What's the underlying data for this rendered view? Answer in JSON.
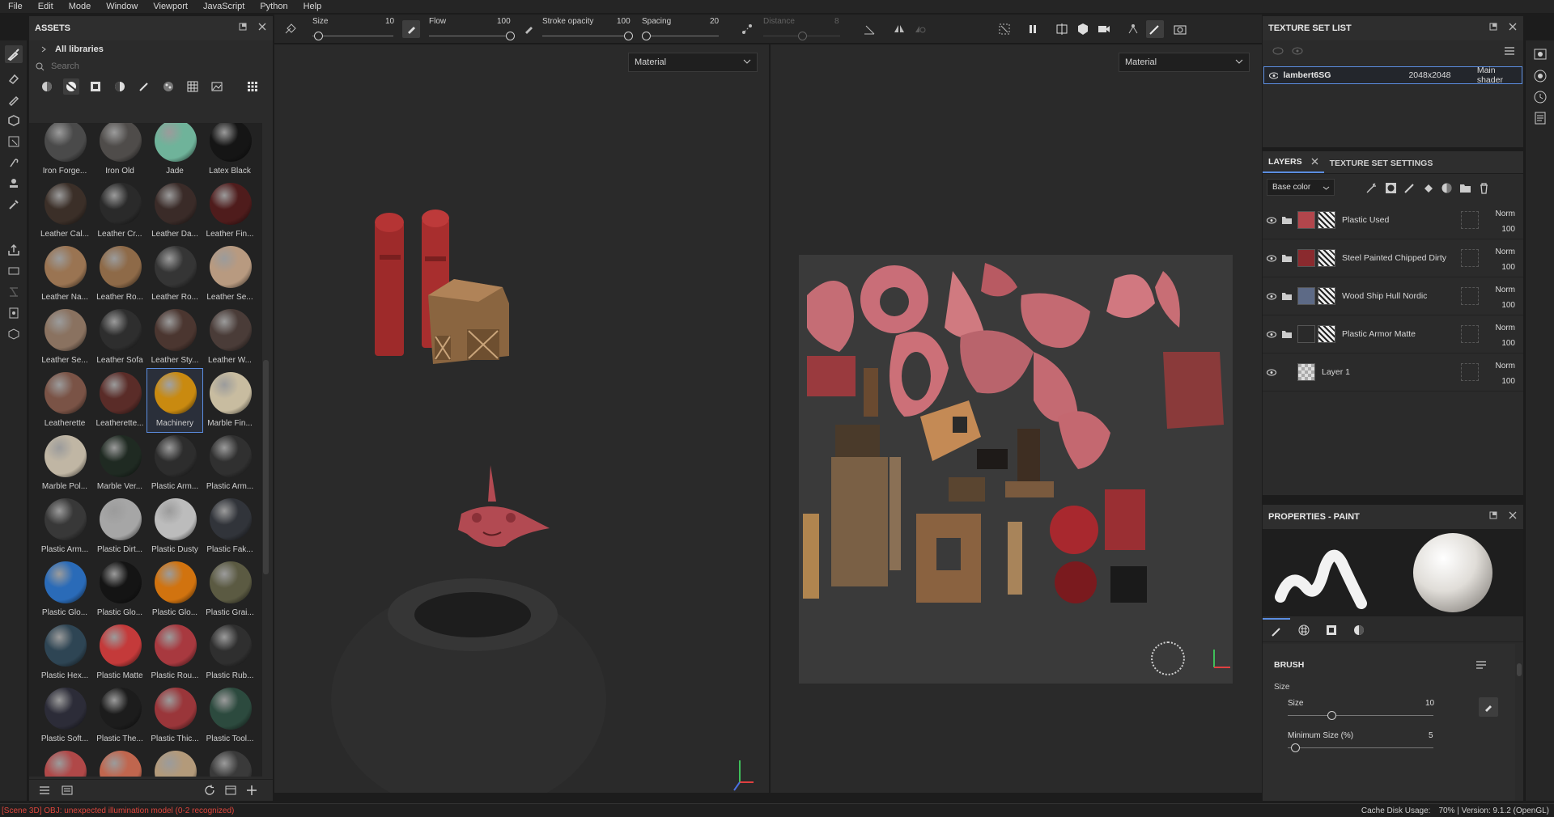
{
  "menu": [
    "File",
    "Edit",
    "Mode",
    "Window",
    "Viewport",
    "JavaScript",
    "Python",
    "Help"
  ],
  "assets": {
    "title": "ASSETS",
    "library": "All libraries",
    "search_placeholder": "Search",
    "materials": [
      {
        "label": "Iron Forge...",
        "color": "#4a4a4a"
      },
      {
        "label": "Iron Old",
        "color": "#4f4c4a"
      },
      {
        "label": "Jade",
        "color": "#6fb39a"
      },
      {
        "label": "Latex Black",
        "color": "#151515"
      },
      {
        "label": "Leather Cal...",
        "color": "#3b2f28"
      },
      {
        "label": "Leather Cr...",
        "color": "#2a2a2a"
      },
      {
        "label": "Leather Da...",
        "color": "#3a2b28"
      },
      {
        "label": "Leather Fin...",
        "color": "#4f1c1c"
      },
      {
        "label": "Leather Na...",
        "color": "#9a7452"
      },
      {
        "label": "Leather Ro...",
        "color": "#8e6a48"
      },
      {
        "label": "Leather Ro...",
        "color": "#353535"
      },
      {
        "label": "Leather Se...",
        "color": "#b89a80"
      },
      {
        "label": "Leather Se...",
        "color": "#8a7260"
      },
      {
        "label": "Leather Sofa",
        "color": "#2e2e2e"
      },
      {
        "label": "Leather Sty...",
        "color": "#4b3630"
      },
      {
        "label": "Leather W...",
        "color": "#4a3c38"
      },
      {
        "label": "Leatherette",
        "color": "#7a5346"
      },
      {
        "label": "Leatherette...",
        "color": "#5a2c28"
      },
      {
        "label": "Machinery",
        "color": "#c98a10"
      },
      {
        "label": "Marble Fin...",
        "color": "#c8bca0"
      },
      {
        "label": "Marble Pol...",
        "color": "#c0b6a4"
      },
      {
        "label": "Marble Ver...",
        "color": "#1f2a22"
      },
      {
        "label": "Plastic Arm...",
        "color": "#2d2d2d"
      },
      {
        "label": "Plastic Arm...",
        "color": "#303030"
      },
      {
        "label": "Plastic Arm...",
        "color": "#383838"
      },
      {
        "label": "Plastic Dirt...",
        "color": "#a6a6a6"
      },
      {
        "label": "Plastic Dusty",
        "color": "#bcbcbc"
      },
      {
        "label": "Plastic Fak...",
        "color": "#31343a"
      },
      {
        "label": "Plastic Glo...",
        "color": "#2a6bb8"
      },
      {
        "label": "Plastic Glo...",
        "color": "#141414"
      },
      {
        "label": "Plastic Glo...",
        "color": "#d1730f"
      },
      {
        "label": "Plastic Grai...",
        "color": "#5b5a42"
      },
      {
        "label": "Plastic Hex...",
        "color": "#2e4554"
      },
      {
        "label": "Plastic Matte",
        "color": "#c43a3a"
      },
      {
        "label": "Plastic Rou...",
        "color": "#a8393f"
      },
      {
        "label": "Plastic Rub...",
        "color": "#2f2f2f"
      },
      {
        "label": "Plastic Soft...",
        "color": "#2c2c38"
      },
      {
        "label": "Plastic The...",
        "color": "#1c1c1c"
      },
      {
        "label": "Plastic Thic...",
        "color": "#9a363a"
      },
      {
        "label": "Plastic Tool...",
        "color": "#2c4a3e"
      },
      {
        "label": "",
        "color": "#b04848"
      },
      {
        "label": "",
        "color": "#c0664e"
      },
      {
        "label": "",
        "color": "#b39a7a"
      },
      {
        "label": "",
        "color": "#3a3a3a"
      }
    ],
    "selected_index": 18
  },
  "toolbar": {
    "size": {
      "label": "Size",
      "value": "10",
      "fraction": 0.07
    },
    "flow": {
      "label": "Flow",
      "value": "100",
      "fraction": 1.0
    },
    "stroke_opacity": {
      "label": "Stroke opacity",
      "value": "100",
      "fraction": 1.0
    },
    "spacing": {
      "label": "Spacing",
      "value": "20",
      "fraction": 0.05
    },
    "distance": {
      "label": "Distance",
      "value": "8",
      "fraction": 0.5
    }
  },
  "viewport3d": {
    "mode": "Material"
  },
  "viewport2d": {
    "mode": "Material"
  },
  "texture_set_list": {
    "title": "TEXTURE SET LIST",
    "row": {
      "name": "lambert6SG",
      "resolution": "2048x2048",
      "shader": "Main shader"
    }
  },
  "layers_panel": {
    "tabs": [
      "LAYERS",
      "TEXTURE SET SETTINGS"
    ],
    "channel": "Base color",
    "layers": [
      {
        "name": "Plastic Used",
        "blend": "Norm",
        "opacity": "100",
        "color": "#b2464c",
        "folder": true
      },
      {
        "name": "Steel Painted Chipped Dirty",
        "blend": "Norm",
        "opacity": "100",
        "color": "#8a2a2e",
        "folder": true
      },
      {
        "name": "Wood Ship Hull Nordic",
        "blend": "Norm",
        "opacity": "100",
        "color": "#5d6a86",
        "folder": true
      },
      {
        "name": "Plastic Armor Matte",
        "blend": "Norm",
        "opacity": "100",
        "color": "#2a2a2a",
        "folder": true
      },
      {
        "name": "Layer 1",
        "blend": "Norm",
        "opacity": "100",
        "color": "#eeeeee",
        "folder": false
      }
    ]
  },
  "properties": {
    "title": "PROPERTIES - PAINT",
    "section": "BRUSH",
    "group": "Size",
    "size": {
      "label": "Size",
      "value": "10",
      "fraction": 0.3
    },
    "min_size": {
      "label": "Minimum Size (%)",
      "value": "5",
      "fraction": 0.05
    }
  },
  "status": {
    "error": "[Scene 3D] OBJ: unexpected illumination model (0-2 recognized)",
    "cache": "Cache Disk Usage:",
    "cache_value": "70% | Version: 9.1.2 (OpenGL)"
  }
}
